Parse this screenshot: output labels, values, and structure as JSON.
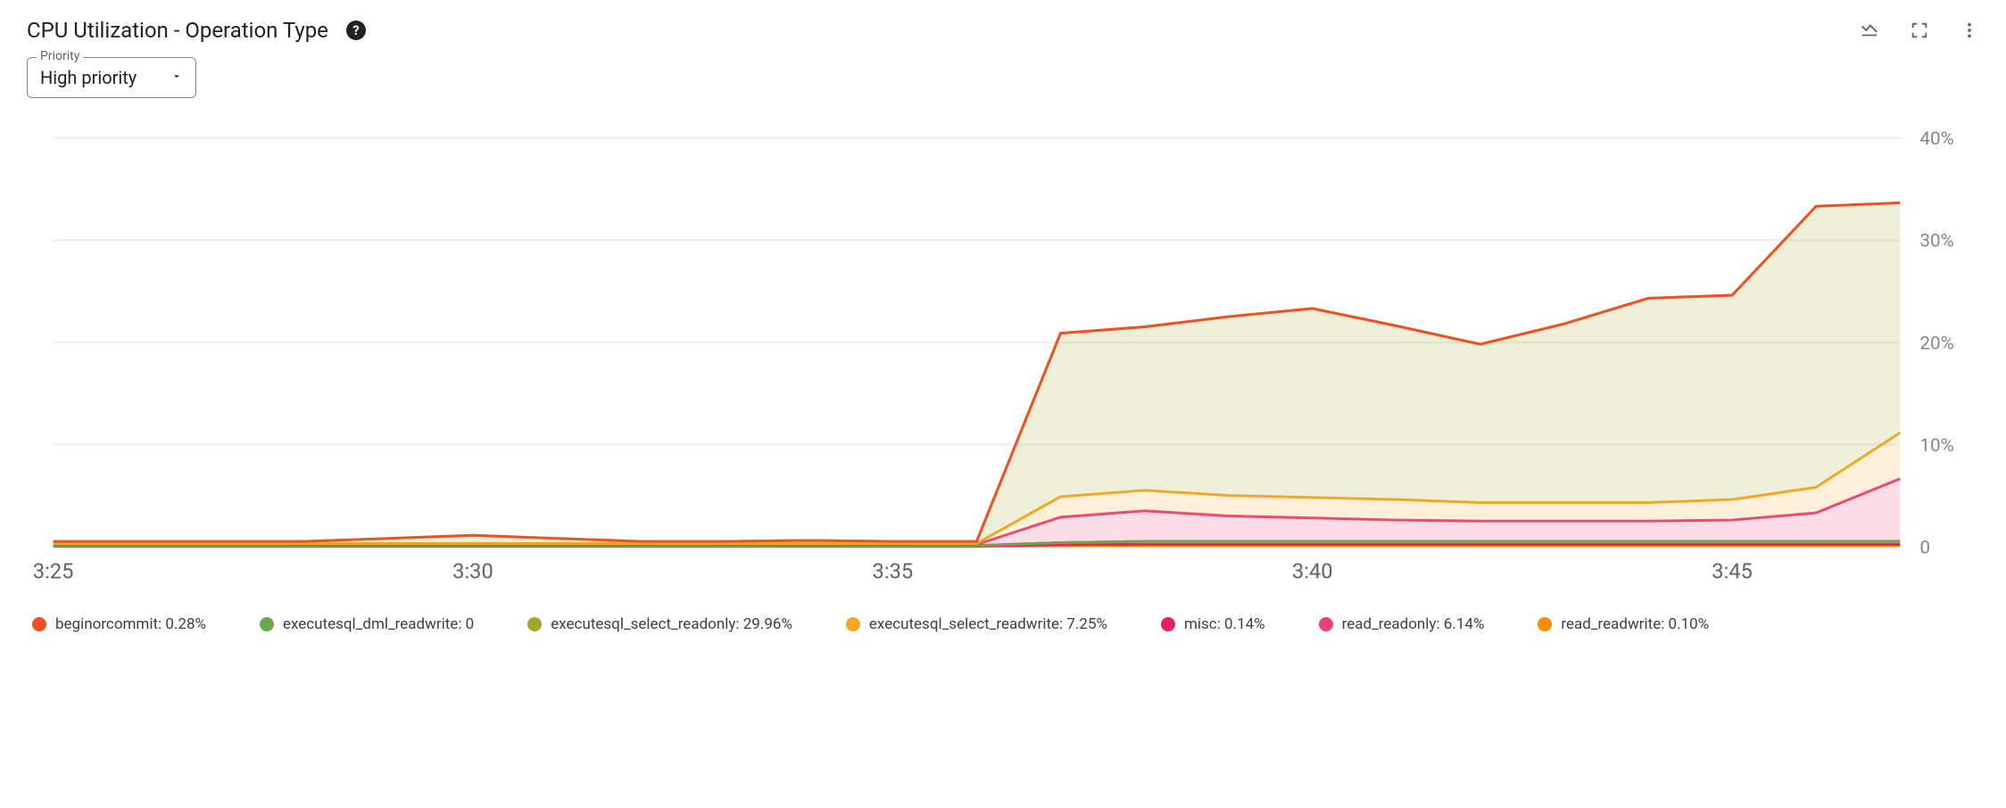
{
  "header": {
    "title": "CPU Utilization - Operation Type"
  },
  "filter": {
    "label": "Priority",
    "value": "High priority"
  },
  "legend": [
    {
      "name": "beginorcommit",
      "value": "0.28%",
      "color": "#f25022"
    },
    {
      "name": "executesql_dml_readwrite",
      "value": "0",
      "color": "#6aa84f"
    },
    {
      "name": "executesql_select_readonly",
      "value": "29.96%",
      "color": "#a2a52d"
    },
    {
      "name": "executesql_select_readwrite",
      "value": "7.25%",
      "color": "#f9a825"
    },
    {
      "name": "misc",
      "value": "0.14%",
      "color": "#e91e63"
    },
    {
      "name": "read_readonly",
      "value": "6.14%",
      "color": "#ec407a"
    },
    {
      "name": "read_readwrite",
      "value": "0.10%",
      "color": "#fb8c00"
    }
  ],
  "chart_data": {
    "type": "area",
    "title": "CPU Utilization - Operation Type",
    "xlabel": "",
    "ylabel": "",
    "ylim": [
      0,
      40
    ],
    "y_ticks": [
      0,
      10,
      20,
      30,
      40
    ],
    "y_tick_labels": [
      "0",
      "10%",
      "20%",
      "30%",
      "40%"
    ],
    "x": [
      205,
      206,
      207,
      208,
      209,
      210,
      211,
      212,
      213,
      214,
      215,
      216,
      217,
      218,
      219,
      220,
      221,
      222,
      223,
      224,
      225,
      226,
      227
    ],
    "x_ticks": [
      205,
      210,
      215,
      220,
      225
    ],
    "x_tick_labels": [
      "3:25",
      "3:30",
      "3:35",
      "3:40",
      "3:45"
    ],
    "stacked": true,
    "series": [
      {
        "name": "read_readwrite",
        "color": "#fb8c00",
        "values": [
          0.05,
          0.05,
          0.05,
          0.05,
          0.05,
          0.05,
          0.05,
          0.05,
          0.05,
          0.05,
          0.05,
          0.05,
          0.1,
          0.1,
          0.1,
          0.1,
          0.1,
          0.1,
          0.1,
          0.1,
          0.1,
          0.1,
          0.1
        ]
      },
      {
        "name": "misc",
        "color": "#e91e63",
        "values": [
          0.02,
          0.02,
          0.02,
          0.02,
          0.02,
          0.02,
          0.02,
          0.02,
          0.02,
          0.02,
          0.02,
          0.02,
          0.1,
          0.14,
          0.14,
          0.14,
          0.14,
          0.14,
          0.14,
          0.14,
          0.14,
          0.14,
          0.14
        ]
      },
      {
        "name": "beginorcommit",
        "color": "#f25022",
        "values": [
          0.05,
          0.05,
          0.05,
          0.05,
          0.05,
          0.05,
          0.05,
          0.05,
          0.05,
          0.05,
          0.05,
          0.05,
          0.2,
          0.28,
          0.28,
          0.28,
          0.28,
          0.28,
          0.28,
          0.28,
          0.28,
          0.28,
          0.28
        ]
      },
      {
        "name": "executesql_dml_readwrite",
        "color": "#6aa84f",
        "values": [
          0,
          0,
          0,
          0,
          0,
          0,
          0,
          0,
          0,
          0,
          0,
          0,
          0,
          0,
          0,
          0,
          0,
          0,
          0,
          0,
          0,
          0,
          0
        ]
      },
      {
        "name": "read_readonly",
        "color": "#ec407a",
        "values": [
          0.1,
          0.1,
          0.1,
          0.1,
          0.1,
          0.1,
          0.1,
          0.1,
          0.1,
          0.1,
          0.1,
          0.1,
          2.5,
          3.0,
          2.5,
          2.3,
          2.1,
          2.0,
          2.0,
          2.0,
          2.1,
          2.8,
          6.14
        ]
      },
      {
        "name": "executesql_select_readwrite",
        "color": "#f9a825",
        "values": [
          0.1,
          0.1,
          0.1,
          0.1,
          0.1,
          0.1,
          0.1,
          0.1,
          0.1,
          0.1,
          0.1,
          0.1,
          2.0,
          2.0,
          2.0,
          2.0,
          2.0,
          1.8,
          1.8,
          1.8,
          2.0,
          2.5,
          4.5
        ]
      },
      {
        "name": "executesql_select_readonly",
        "color": "#a2a52d",
        "values": [
          0.2,
          0.2,
          0.2,
          0.2,
          0.5,
          0.8,
          0.5,
          0.2,
          0.2,
          0.3,
          0.2,
          0.2,
          16.0,
          16.0,
          17.5,
          18.5,
          17.0,
          15.5,
          17.5,
          20.0,
          20.0,
          27.5,
          22.5
        ]
      }
    ]
  }
}
